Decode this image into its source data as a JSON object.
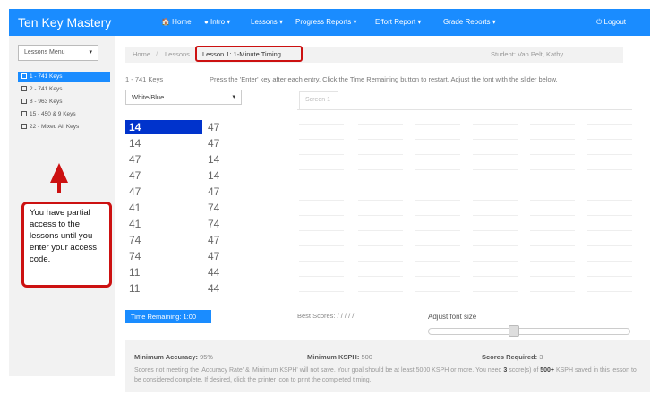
{
  "app": {
    "brand": "Ten Key Mastery"
  },
  "nav": {
    "home": "🏠 Home",
    "intro": "● Intro ▾",
    "lessons": "Lessons ▾",
    "progress": "Progress Reports ▾",
    "effort": "Effort Report ▾",
    "grade": "Grade Reports ▾",
    "logout": "⏻ Logout"
  },
  "sidebar": {
    "menu_label": "Lessons Menu",
    "items": [
      {
        "label": "1 - 741 Keys",
        "active": true
      },
      {
        "label": "2 - 741 Keys"
      },
      {
        "label": "8 - 963 Keys"
      },
      {
        "label": "15 - 450 & 9 Keys"
      },
      {
        "label": "22 - Mixed All Keys"
      }
    ],
    "note": "You have partial access to the lessons until you enter your access code."
  },
  "breadcrumb": {
    "home": "Home",
    "sep": "/",
    "lessons": "Lessons",
    "current": "Lesson 1: 1-Minute Timing"
  },
  "student": "Student: Van Pelt, Kathy",
  "lesson": {
    "keys_label": "1 - 741 Keys",
    "instructions": "Press the 'Enter' key after each entry. Click the Time Remaining button to restart. Adjust the font with the slider below.",
    "color_option": "White/Blue",
    "screen_tab": "Screen 1"
  },
  "keys": [
    {
      "a": "14",
      "b": "47"
    },
    {
      "a": "14",
      "b": "47"
    },
    {
      "a": "47",
      "b": "14"
    },
    {
      "a": "47",
      "b": "14"
    },
    {
      "a": "47",
      "b": "47"
    },
    {
      "a": "41",
      "b": "74"
    },
    {
      "a": "41",
      "b": "74"
    },
    {
      "a": "74",
      "b": "47"
    },
    {
      "a": "74",
      "b": "47"
    },
    {
      "a": "11",
      "b": "44"
    },
    {
      "a": "11",
      "b": "44"
    }
  ],
  "best_scores": "Best Scores:   /    /    /    /    /",
  "time_button": "Time Remaining: 1:00",
  "font_size_label": "Adjust font size",
  "font_slider": {
    "value": 0.42
  },
  "requirements": {
    "accuracy_label": "Minimum Accuracy:",
    "accuracy_value": "95%",
    "kspf_label": "Minimum KSPH:",
    "kspf_value": "500",
    "scores_label": "Scores Required:",
    "scores_value": "3"
  },
  "footer_note": {
    "part1": "Scores not meeting the 'Accuracy Rate' & 'Minimum KSPH' will not save. Your goal should be at least 5000 KSPH or more. You need ",
    "bold1": "3",
    "part2": " score(s) of ",
    "bold2": "500+",
    "part3": " KSPH saved in this lesson to be considered complete. If desired, click the printer icon to print the completed timing."
  },
  "colors": {
    "topbar": "#1a8cff",
    "active_key": "#0033cc",
    "annotation": "#cc1111"
  }
}
